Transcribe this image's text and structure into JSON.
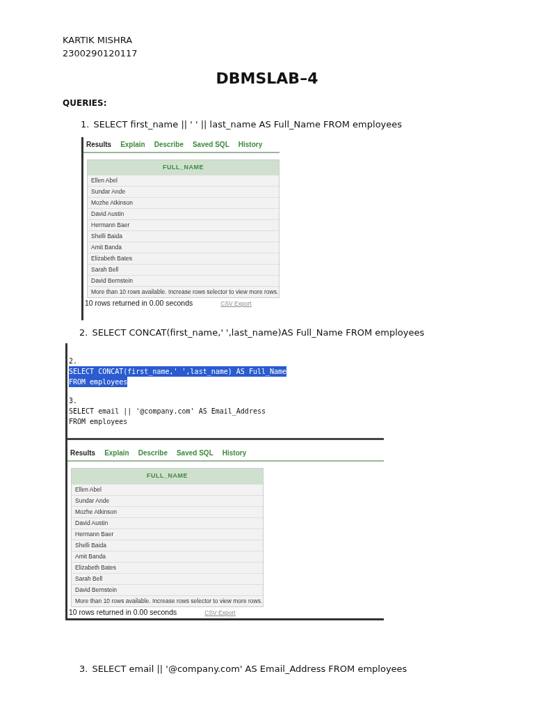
{
  "author": {
    "name": "KARTIK MISHRA",
    "id": "2300290120117"
  },
  "title": "DBMSLAB–4",
  "section_label": "QUERIES:",
  "queries": [
    {
      "number": "1.",
      "sql": "SELECT first_name || ' ' || last_name AS Full_Name FROM employees",
      "screenshot": {
        "tabs": [
          {
            "label": "Results",
            "selected": true
          },
          {
            "label": "Explain",
            "selected": false
          },
          {
            "label": "Describe",
            "selected": false
          },
          {
            "label": "Saved SQL",
            "selected": false
          },
          {
            "label": "History",
            "selected": false
          }
        ],
        "column": "FULL_NAME",
        "rows": [
          "Ellen Abel",
          "Sundar Ande",
          "Mozhe Atkinson",
          "David Austin",
          "Hermann Baer",
          "Shelli Baida",
          "Amit Banda",
          "Elizabeth Bates",
          "Sarah Bell",
          "David Bernstein"
        ],
        "note": "More than 10 rows available. Increase rows selector to view more rows.",
        "status": "10 rows returned in 0.00 seconds",
        "export": "CSV Export"
      }
    },
    {
      "number": "2.",
      "sql": "SELECT CONCAT(first_name,' ',last_name)AS Full_Name FROM employees",
      "screenshot": {
        "editor_blocks": [
          {
            "lines": [
              {
                "text": "2.",
                "selected": false
              },
              {
                "text": "SELECT CONCAT(first_name,' ',last_name) AS Full_Name",
                "selected": true
              },
              {
                "text": "FROM employees",
                "selected": true
              }
            ]
          },
          {
            "lines": [
              {
                "text": "3.",
                "selected": false
              },
              {
                "text": "SELECT email || '@company.com' AS Email_Address",
                "selected": false
              },
              {
                "text": "FROM employees",
                "selected": false
              }
            ]
          }
        ],
        "tabs": [
          {
            "label": "Results",
            "selected": true
          },
          {
            "label": "Explain",
            "selected": false
          },
          {
            "label": "Describe",
            "selected": false
          },
          {
            "label": "Saved SQL",
            "selected": false
          },
          {
            "label": "History",
            "selected": false
          }
        ],
        "column": "FULL_NAME",
        "rows": [
          "Ellen Abel",
          "Sundar Ande",
          "Mozhe Atkinson",
          "David Austin",
          "Hermann Baer",
          "Shelli Baida",
          "Amit Banda",
          "Elizabeth Bates",
          "Sarah Bell",
          "David Bernstein"
        ],
        "note": "More than 10 rows available. Increase rows selector to view more rows.",
        "status": "10 rows returned in 0.00 seconds",
        "export": "CSV Export"
      }
    },
    {
      "number": "3.",
      "sql": "SELECT email || '@company.com' AS Email_Address FROM employees"
    }
  ]
}
